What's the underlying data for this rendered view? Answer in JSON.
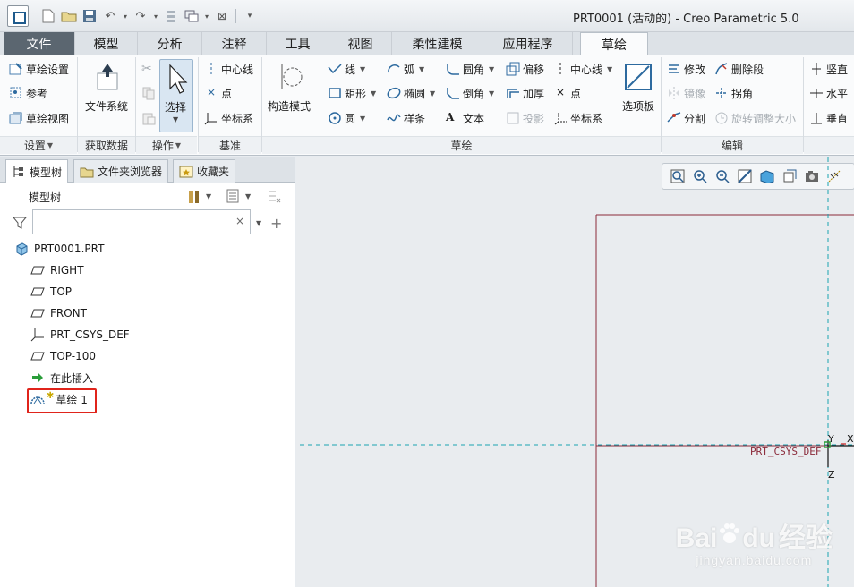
{
  "window": {
    "title": "PRT0001 (活动的) - Creo Parametric 5.0"
  },
  "ribbon_tabs": [
    {
      "label": "文件"
    },
    {
      "label": "模型"
    },
    {
      "label": "分析"
    },
    {
      "label": "注释"
    },
    {
      "label": "工具"
    },
    {
      "label": "视图"
    },
    {
      "label": "柔性建模"
    },
    {
      "label": "应用程序"
    },
    {
      "label": "草绘"
    }
  ],
  "ribbon": {
    "setup": {
      "sketch_setup": "草绘设置",
      "references": "参考",
      "sketch_view": "草绘视图",
      "group": "设置"
    },
    "get_data": {
      "file_system": "文件系统",
      "group": "获取数据"
    },
    "operations": {
      "select": "选择",
      "group": "操作"
    },
    "datum": {
      "centerline": "中心线",
      "point": "点",
      "csys": "坐标系",
      "group": "基准"
    },
    "sketching": {
      "construction_mode": "构造模式",
      "line": "线",
      "arc": "弧",
      "fillet": "圆角",
      "offset": "偏移",
      "centerline": "中心线",
      "rectangle": "矩形",
      "ellipse": "椭圆",
      "chamfer": "倒角",
      "thicken": "加厚",
      "point": "点",
      "circle": "圆",
      "spline": "样条",
      "text": "文本",
      "project": "投影",
      "csys": "坐标系",
      "palette": "选项板",
      "group": "草绘"
    },
    "editing": {
      "modify": "修改",
      "delete_segment": "删除段",
      "mirror": "镜像",
      "corner": "拐角",
      "divide": "分割",
      "rotate_resize": "旋转调整大小",
      "group": "编辑"
    },
    "constrain": {
      "vertical": "竖直",
      "horizontal": "水平",
      "perpendicular": "垂直"
    }
  },
  "left_panel": {
    "tabs": [
      {
        "label": "模型树"
      },
      {
        "label": "文件夹浏览器"
      },
      {
        "label": "收藏夹"
      }
    ],
    "title": "模型树",
    "search_value": "",
    "tree": [
      {
        "label": "PRT0001.PRT"
      },
      {
        "label": "RIGHT"
      },
      {
        "label": "TOP"
      },
      {
        "label": "FRONT"
      },
      {
        "label": "PRT_CSYS_DEF"
      },
      {
        "label": "TOP-100"
      },
      {
        "label": "在此插入"
      },
      {
        "label": "草绘 1"
      }
    ]
  },
  "graphics": {
    "csys_label": "PRT_CSYS_DEF",
    "axis_y": "Y",
    "axis_z": "Z",
    "axis_x": "X"
  },
  "watermark": {
    "brand_left": "Bai",
    "brand_right": "du",
    "brand_cn": "经验",
    "url": "jingyan.baidu.com"
  },
  "colors": {
    "highlight": "#e0241b",
    "accent": "#1e5a8c",
    "sketch_line": "#8b2a3a",
    "datum_cyan": "#1aa3b0"
  }
}
